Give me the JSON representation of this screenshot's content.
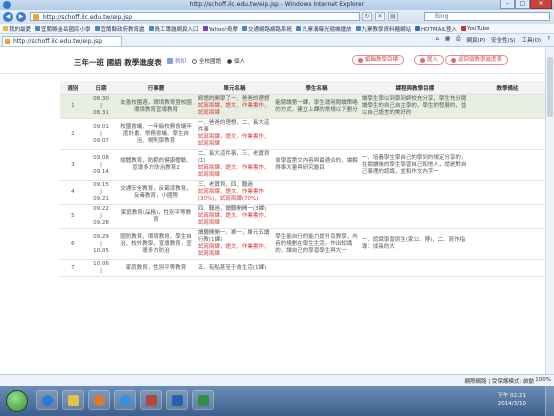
{
  "window": {
    "title": "http://schoff.ilc.edu.tw/eip.jsp - Windows Internet Explorer"
  },
  "browser": {
    "url": "http://schoff.ilc.edu.tw/eip.jsp",
    "search_placeholder": "Bing",
    "tab_title": "http://schoff.ilc.edu.tw/eip.jsp",
    "favorites_label": "我的最愛",
    "favorites": [
      "宜蘭縣金岳國民小學",
      "宜蘭縣政府教育處",
      "員工專題網頁入口",
      "Yahoo!奇摩",
      "交通網路網路系統",
      "九寨溝曝光隨機播放",
      "九寨教學資料櫃網站",
      "HOTMAIL登入",
      "YouTube"
    ],
    "command_tools": [
      "網頁(P)",
      "安全性(S)",
      "工具(O)"
    ],
    "status_text": "網際網路 | 受保護模式: 啟動",
    "zoom": "100%"
  },
  "page": {
    "title": "三年一班 國語 教學進度表",
    "print_label": "列印",
    "radio_options": [
      {
        "label": "全校國語",
        "selected": false
      },
      {
        "label": "個人",
        "selected": true
      }
    ],
    "buttons": {
      "edit": "編輯教學目標",
      "import": "匯入",
      "back": "返回個教學進度表"
    },
    "columns": [
      "週別",
      "日期",
      "行事曆",
      "單元名稱",
      "學生名稱",
      "課程與教學目標",
      "教學備註"
    ],
    "rows": [
      {
        "week": "1",
        "date_start": "08.30",
        "date_end": "08.31",
        "event": "友善校園週，環境教育暨校園環境教育宣導教育",
        "unit": "師語的開學了一、爸爸的理想",
        "unit_red": "試寫兩課，語文、作業書作，試寫兩課",
        "goal": "能閱讀第一課，學生運用閱讀策略的方式，建立上課的常規以下劃分",
        "requirement": "讓學生學以到學到師校充分享，學生充分閱讀學生的自己自主學的，學生的發展的，並以自己語言的美好的",
        "note": "",
        "highlight": true
      },
      {
        "week": "2",
        "date_start": "09.01",
        "date_end": "09.07",
        "event": "校園會議、一年級校務會議年度計畫、常務會議、學生自治、規則學教育",
        "unit": "一、爸爸的理想，二、長大這件事",
        "unit_red": "試寫兩課，語文、作業書作，試寫兩課",
        "goal": "",
        "requirement": "",
        "note": "",
        "highlight": false
      },
      {
        "week": "3",
        "date_start": "09.08",
        "date_end": "09.14",
        "event": "總體教育，防範的健康體驗、宣導多方防治教育2",
        "unit": "二、長大這件事，三、老寶貝(1)",
        "unit_red": "試寫兩課，語文、作業書作，試寫兩課",
        "goal": "會學習第文內容與最適合的，讓解得事大量與研究題目",
        "requirement": "一、培養學生學自己的學到的規定分享的，在閱讀後的學生學習自己和他人，請是對自己事理的認識，並和作文內字一",
        "note": "",
        "highlight": false
      },
      {
        "week": "4",
        "date_start": "09.15",
        "date_end": "09.21",
        "event": "交通安全教育，反霸凌教育，反毒教育，小國際",
        "unit": "三、老寶貝，四、聽過",
        "unit_red": "試寫兩課，語文、作業書作(30%)，試寫兩課(70%)",
        "goal": "",
        "requirement": "",
        "note": "",
        "highlight": false
      },
      {
        "week": "5",
        "date_start": "09.22",
        "date_end": "09.28",
        "event": "家庭教育(品格)，性別平等教育",
        "unit": "四、聽過，讀聽開開一(3課)",
        "unit_red": "試寫兩課，語文、作業書作，試寫兩課",
        "goal": "",
        "requirement": "",
        "note": "",
        "highlight": false
      },
      {
        "week": "6",
        "date_start": "09.29",
        "date_end": "10.05",
        "event": "國防教育，環境教育，學生自治、校外教學，宣導教育，宣導多方防治",
        "unit": "讀聽開開一、單一，單元五讀行教(1課)",
        "unit_red": "試寫兩課，語文、作業書作，試寫兩課",
        "goal": "學生能自行的能力提升及教學，內容的規劃在學生生活，作出知識的，讓自己的學習學生與大一",
        "requirement": "一、認識學習原生(家公、博)，二、寫作指導：成長的大",
        "note": "",
        "highlight": false
      },
      {
        "week": "7",
        "date_start": "10.06",
        "date_end": "",
        "event": "家庭教育，性別平等教育",
        "unit": "五、有點甚至于會生活(1課)",
        "unit_red": "",
        "goal": "",
        "requirement": "",
        "note": "",
        "highlight": false
      }
    ]
  },
  "taskbar": {
    "time": "下午 02:21",
    "date": "2014/3/10"
  },
  "colors": {
    "highlight_row": "#e7efe2",
    "red_text": "#d53a3a",
    "taskbar": "#3d5f8b"
  }
}
